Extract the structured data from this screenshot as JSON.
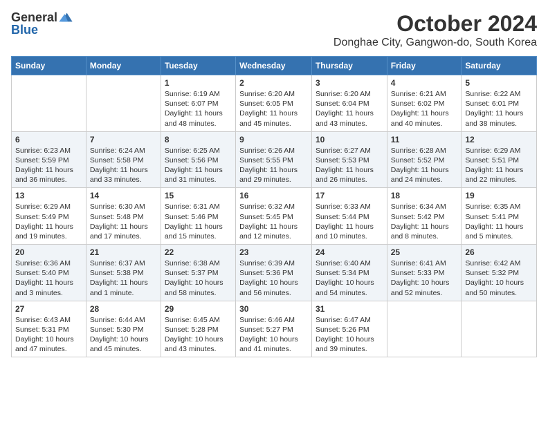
{
  "header": {
    "logo_general": "General",
    "logo_blue": "Blue",
    "title": "October 2024",
    "subtitle": "Donghae City, Gangwon-do, South Korea"
  },
  "days_of_week": [
    "Sunday",
    "Monday",
    "Tuesday",
    "Wednesday",
    "Thursday",
    "Friday",
    "Saturday"
  ],
  "weeks": [
    [
      {
        "day": "",
        "sunrise": "",
        "sunset": "",
        "daylight": ""
      },
      {
        "day": "",
        "sunrise": "",
        "sunset": "",
        "daylight": ""
      },
      {
        "day": "1",
        "sunrise": "Sunrise: 6:19 AM",
        "sunset": "Sunset: 6:07 PM",
        "daylight": "Daylight: 11 hours and 48 minutes."
      },
      {
        "day": "2",
        "sunrise": "Sunrise: 6:20 AM",
        "sunset": "Sunset: 6:05 PM",
        "daylight": "Daylight: 11 hours and 45 minutes."
      },
      {
        "day": "3",
        "sunrise": "Sunrise: 6:20 AM",
        "sunset": "Sunset: 6:04 PM",
        "daylight": "Daylight: 11 hours and 43 minutes."
      },
      {
        "day": "4",
        "sunrise": "Sunrise: 6:21 AM",
        "sunset": "Sunset: 6:02 PM",
        "daylight": "Daylight: 11 hours and 40 minutes."
      },
      {
        "day": "5",
        "sunrise": "Sunrise: 6:22 AM",
        "sunset": "Sunset: 6:01 PM",
        "daylight": "Daylight: 11 hours and 38 minutes."
      }
    ],
    [
      {
        "day": "6",
        "sunrise": "Sunrise: 6:23 AM",
        "sunset": "Sunset: 5:59 PM",
        "daylight": "Daylight: 11 hours and 36 minutes."
      },
      {
        "day": "7",
        "sunrise": "Sunrise: 6:24 AM",
        "sunset": "Sunset: 5:58 PM",
        "daylight": "Daylight: 11 hours and 33 minutes."
      },
      {
        "day": "8",
        "sunrise": "Sunrise: 6:25 AM",
        "sunset": "Sunset: 5:56 PM",
        "daylight": "Daylight: 11 hours and 31 minutes."
      },
      {
        "day": "9",
        "sunrise": "Sunrise: 6:26 AM",
        "sunset": "Sunset: 5:55 PM",
        "daylight": "Daylight: 11 hours and 29 minutes."
      },
      {
        "day": "10",
        "sunrise": "Sunrise: 6:27 AM",
        "sunset": "Sunset: 5:53 PM",
        "daylight": "Daylight: 11 hours and 26 minutes."
      },
      {
        "day": "11",
        "sunrise": "Sunrise: 6:28 AM",
        "sunset": "Sunset: 5:52 PM",
        "daylight": "Daylight: 11 hours and 24 minutes."
      },
      {
        "day": "12",
        "sunrise": "Sunrise: 6:29 AM",
        "sunset": "Sunset: 5:51 PM",
        "daylight": "Daylight: 11 hours and 22 minutes."
      }
    ],
    [
      {
        "day": "13",
        "sunrise": "Sunrise: 6:29 AM",
        "sunset": "Sunset: 5:49 PM",
        "daylight": "Daylight: 11 hours and 19 minutes."
      },
      {
        "day": "14",
        "sunrise": "Sunrise: 6:30 AM",
        "sunset": "Sunset: 5:48 PM",
        "daylight": "Daylight: 11 hours and 17 minutes."
      },
      {
        "day": "15",
        "sunrise": "Sunrise: 6:31 AM",
        "sunset": "Sunset: 5:46 PM",
        "daylight": "Daylight: 11 hours and 15 minutes."
      },
      {
        "day": "16",
        "sunrise": "Sunrise: 6:32 AM",
        "sunset": "Sunset: 5:45 PM",
        "daylight": "Daylight: 11 hours and 12 minutes."
      },
      {
        "day": "17",
        "sunrise": "Sunrise: 6:33 AM",
        "sunset": "Sunset: 5:44 PM",
        "daylight": "Daylight: 11 hours and 10 minutes."
      },
      {
        "day": "18",
        "sunrise": "Sunrise: 6:34 AM",
        "sunset": "Sunset: 5:42 PM",
        "daylight": "Daylight: 11 hours and 8 minutes."
      },
      {
        "day": "19",
        "sunrise": "Sunrise: 6:35 AM",
        "sunset": "Sunset: 5:41 PM",
        "daylight": "Daylight: 11 hours and 5 minutes."
      }
    ],
    [
      {
        "day": "20",
        "sunrise": "Sunrise: 6:36 AM",
        "sunset": "Sunset: 5:40 PM",
        "daylight": "Daylight: 11 hours and 3 minutes."
      },
      {
        "day": "21",
        "sunrise": "Sunrise: 6:37 AM",
        "sunset": "Sunset: 5:38 PM",
        "daylight": "Daylight: 11 hours and 1 minute."
      },
      {
        "day": "22",
        "sunrise": "Sunrise: 6:38 AM",
        "sunset": "Sunset: 5:37 PM",
        "daylight": "Daylight: 10 hours and 58 minutes."
      },
      {
        "day": "23",
        "sunrise": "Sunrise: 6:39 AM",
        "sunset": "Sunset: 5:36 PM",
        "daylight": "Daylight: 10 hours and 56 minutes."
      },
      {
        "day": "24",
        "sunrise": "Sunrise: 6:40 AM",
        "sunset": "Sunset: 5:34 PM",
        "daylight": "Daylight: 10 hours and 54 minutes."
      },
      {
        "day": "25",
        "sunrise": "Sunrise: 6:41 AM",
        "sunset": "Sunset: 5:33 PM",
        "daylight": "Daylight: 10 hours and 52 minutes."
      },
      {
        "day": "26",
        "sunrise": "Sunrise: 6:42 AM",
        "sunset": "Sunset: 5:32 PM",
        "daylight": "Daylight: 10 hours and 50 minutes."
      }
    ],
    [
      {
        "day": "27",
        "sunrise": "Sunrise: 6:43 AM",
        "sunset": "Sunset: 5:31 PM",
        "daylight": "Daylight: 10 hours and 47 minutes."
      },
      {
        "day": "28",
        "sunrise": "Sunrise: 6:44 AM",
        "sunset": "Sunset: 5:30 PM",
        "daylight": "Daylight: 10 hours and 45 minutes."
      },
      {
        "day": "29",
        "sunrise": "Sunrise: 6:45 AM",
        "sunset": "Sunset: 5:28 PM",
        "daylight": "Daylight: 10 hours and 43 minutes."
      },
      {
        "day": "30",
        "sunrise": "Sunrise: 6:46 AM",
        "sunset": "Sunset: 5:27 PM",
        "daylight": "Daylight: 10 hours and 41 minutes."
      },
      {
        "day": "31",
        "sunrise": "Sunrise: 6:47 AM",
        "sunset": "Sunset: 5:26 PM",
        "daylight": "Daylight: 10 hours and 39 minutes."
      },
      {
        "day": "",
        "sunrise": "",
        "sunset": "",
        "daylight": ""
      },
      {
        "day": "",
        "sunrise": "",
        "sunset": "",
        "daylight": ""
      }
    ]
  ]
}
